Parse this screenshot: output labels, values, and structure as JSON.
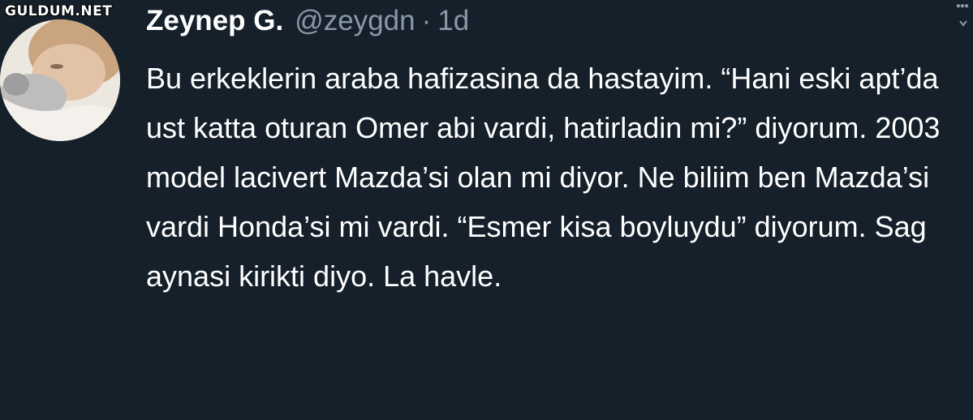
{
  "watermark": "GULDUM.NET",
  "tweet": {
    "author_name": "Zeynep G.",
    "handle": "@zeygdn",
    "separator": "·",
    "time": "1d",
    "text": "Bu erkeklerin araba hafizasina da hastayim. “Hani eski apt’da ust katta oturan Omer abi vardi, hatirladin mi?” diyorum. 2003 model lacivert Mazda’si olan mi diyor. Ne biliim ben Mazda’si vardi Honda’si mi vardi. “Esmer kisa boyluydu” diyorum. Sag aynasi kirikti diyo. La havle."
  },
  "icons": {
    "more": "more-dots-icon",
    "caret": "chevron-down-icon"
  },
  "colors": {
    "background": "#15202b",
    "text": "#ffffff",
    "secondary": "#8899a6"
  }
}
